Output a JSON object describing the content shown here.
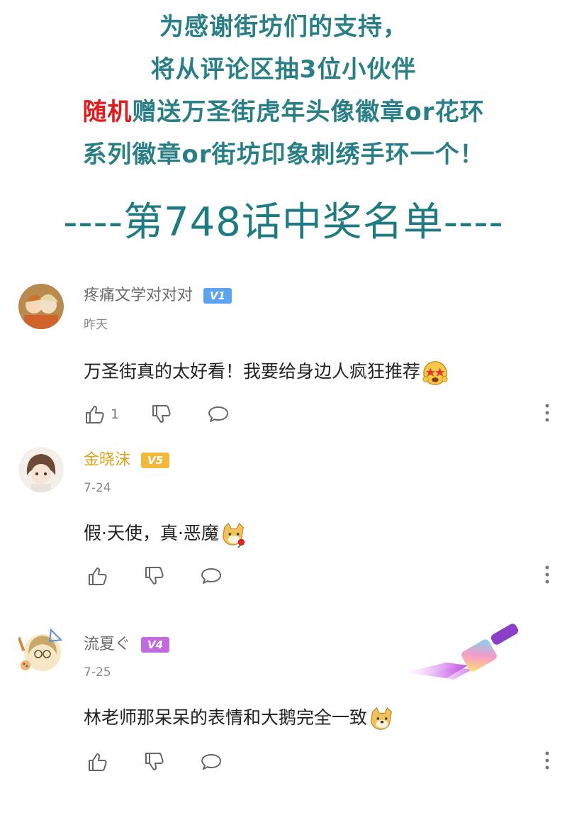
{
  "banner": {
    "line1": "为感谢街坊们的支持，",
    "line2": "将从评论区抽3位小伙伴",
    "line3_highlight": "随机",
    "line3_rest": "赠送万圣街虎年头像徽章or花环",
    "line4": "系列徽章or街坊印象刺绣手环一个！",
    "winners_title": "----第748话中奖名单----"
  },
  "colors": {
    "accent": "#2a7f86",
    "highlight": "#e11b1b",
    "gold_name": "#d9a21b"
  },
  "comments": [
    {
      "username": "疼痛文学对对对",
      "level": "V1",
      "date": "昨天",
      "text": "万圣街真的太好看！我要给身边人疯狂推荐",
      "emoji": "starry-eyed-emoji",
      "like_count": "1"
    },
    {
      "username": "金晓沫",
      "level": "V5",
      "date": "7-24",
      "text": "假·天使，真·恶魔",
      "emoji": "doge-rose-emoji",
      "like_count": ""
    },
    {
      "username": "流夏ぐ",
      "level": "V4",
      "date": "7-25",
      "text": "林老师那呆呆的表情和大鹅完全一致",
      "emoji": "doge-emoji",
      "like_count": ""
    }
  ]
}
